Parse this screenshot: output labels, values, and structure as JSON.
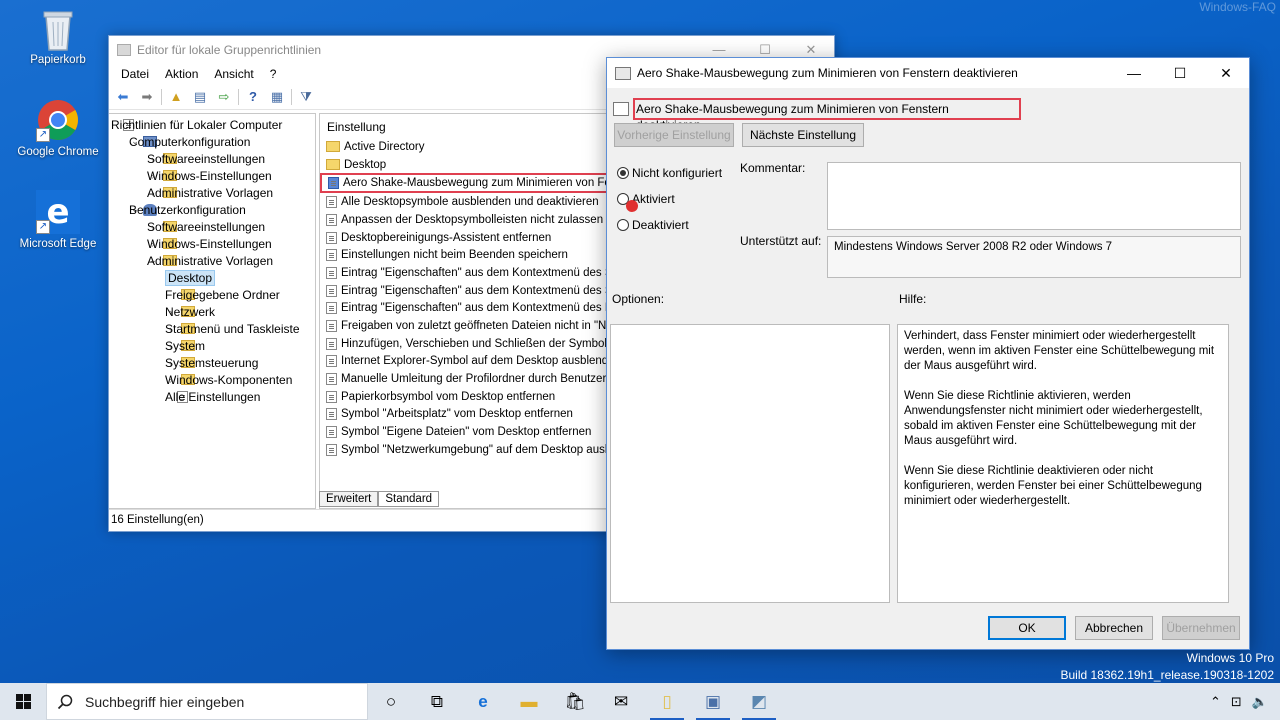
{
  "watermark": "Windows-FAQ",
  "desktop": {
    "icons": [
      {
        "label": "Papierkorb"
      },
      {
        "label": "Google Chrome"
      },
      {
        "label": "Microsoft Edge"
      }
    ],
    "winver_line1": "Windows 10 Pro",
    "winver_line2": "Build 18362.19h1_release.190318-1202"
  },
  "gpe": {
    "title": "Editor für lokale Gruppenrichtlinien",
    "menu": [
      "Datei",
      "Aktion",
      "Ansicht",
      "?"
    ],
    "tree": [
      {
        "label": "Richtlinien für Lokaler Computer",
        "level": 0,
        "icon": "policy-icon"
      },
      {
        "label": "Computerkonfiguration",
        "level": 1,
        "icon": "computer-icon",
        "twisty": "⌄"
      },
      {
        "label": "Softwareeinstellungen",
        "level": 2,
        "twisty": "›"
      },
      {
        "label": "Windows-Einstellungen",
        "level": 2,
        "twisty": "›"
      },
      {
        "label": "Administrative Vorlagen",
        "level": 2,
        "twisty": "›"
      },
      {
        "label": "Benutzerkonfiguration",
        "level": 1,
        "icon": "user-icon",
        "twisty": "⌄"
      },
      {
        "label": "Softwareeinstellungen",
        "level": 2,
        "twisty": "›"
      },
      {
        "label": "Windows-Einstellungen",
        "level": 2,
        "twisty": "›"
      },
      {
        "label": "Administrative Vorlagen",
        "level": 2,
        "twisty": "⌄"
      },
      {
        "label": "Desktop",
        "level": 3,
        "twisty": "›",
        "selected": true
      },
      {
        "label": "Freigegebene Ordner",
        "level": 3,
        "twisty": ""
      },
      {
        "label": "Netzwerk",
        "level": 3,
        "twisty": "›"
      },
      {
        "label": "Startmenü und Taskleiste",
        "level": 3,
        "twisty": "›"
      },
      {
        "label": "System",
        "level": 3,
        "twisty": "›"
      },
      {
        "label": "Systemsteuerung",
        "level": 3,
        "twisty": "›"
      },
      {
        "label": "Windows-Komponenten",
        "level": 3,
        "twisty": "›"
      },
      {
        "label": "Alle Einstellungen",
        "level": 3,
        "twisty": "",
        "icon": "settings-icon"
      }
    ],
    "list_header": "Einstellung",
    "list": [
      {
        "label": "Active Directory",
        "type": "folder"
      },
      {
        "label": "Desktop",
        "type": "folder"
      },
      {
        "label": "Aero Shake-Mausbewegung zum Minimieren von Fenstern deaktivieren",
        "type": "policy",
        "highlight": true
      },
      {
        "label": "Alle Desktopsymbole ausblenden und deaktivieren",
        "type": "policy"
      },
      {
        "label": "Anpassen der Desktopsymbolleisten nicht zulassen",
        "type": "policy"
      },
      {
        "label": "Desktopbereinigungs-Assistent entfernen",
        "type": "policy"
      },
      {
        "label": "Einstellungen nicht beim Beenden speichern",
        "type": "policy"
      },
      {
        "label": "Eintrag \"Eigenschaften\" aus dem Kontextmenü des Symbols",
        "type": "policy"
      },
      {
        "label": "Eintrag \"Eigenschaften\" aus dem Kontextmenü des Symbols",
        "type": "policy"
      },
      {
        "label": "Eintrag \"Eigenschaften\" aus dem Kontextmenü des Papierkorbs",
        "type": "policy"
      },
      {
        "label": "Freigaben von zuletzt geöffneten Dateien nicht in \"Netzwerk\"",
        "type": "policy"
      },
      {
        "label": "Hinzufügen, Verschieben und Schließen der Symbolleisten",
        "type": "policy"
      },
      {
        "label": "Internet Explorer-Symbol auf dem Desktop ausblenden",
        "type": "policy"
      },
      {
        "label": "Manuelle Umleitung der Profilordner durch Benutzer verhindern",
        "type": "policy"
      },
      {
        "label": "Papierkorbsymbol vom Desktop entfernen",
        "type": "policy"
      },
      {
        "label": "Symbol \"Arbeitsplatz\" vom Desktop entfernen",
        "type": "policy"
      },
      {
        "label": "Symbol \"Eigene Dateien\" vom Desktop entfernen",
        "type": "policy"
      },
      {
        "label": "Symbol \"Netzwerkumgebung\" auf dem Desktop ausblenden",
        "type": "policy"
      }
    ],
    "tabs": [
      "Erweitert",
      "Standard"
    ],
    "status": "16 Einstellung(en)"
  },
  "dialog": {
    "title": "Aero Shake-Mausbewegung zum Minimieren von Fenstern deaktivieren",
    "policy_name": "Aero Shake-Mausbewegung zum Minimieren von Fenstern deaktivieren",
    "prev_button": "Vorherige Einstellung",
    "next_button": "Nächste Einstellung",
    "radio_not_configured": "Nicht konfiguriert",
    "radio_enabled": "Aktiviert",
    "radio_disabled": "Deaktiviert",
    "selected": "Nicht konfiguriert",
    "comment_label": "Kommentar:",
    "supported_label": "Unterstützt auf:",
    "supported_value": "Mindestens Windows Server 2008 R2 oder Windows 7",
    "options_label": "Optionen:",
    "help_label": "Hilfe:",
    "help_paragraphs": [
      "Verhindert, dass Fenster minimiert oder wiederhergestellt werden, wenn im aktiven Fenster eine Schüttelbewegung mit der Maus ausgeführt wird.",
      "Wenn Sie diese Richtlinie aktivieren, werden Anwendungsfenster nicht minimiert oder wiederhergestellt, sobald im aktiven Fenster eine Schüttelbewegung mit der Maus ausgeführt wird.",
      "Wenn Sie diese Richtlinie deaktivieren oder nicht konfigurieren, werden Fenster bei einer Schüttelbewegung minimiert oder wiederhergestellt."
    ],
    "ok_button": "OK",
    "cancel_button": "Abbrechen",
    "apply_button": "Übernehmen"
  },
  "taskbar": {
    "search_placeholder": "Suchbegriff hier eingeben",
    "icons": [
      "cortana-icon",
      "task-view-icon",
      "edge-icon",
      "explorer-icon",
      "store-icon",
      "mail-icon",
      "notepad-icon",
      "gpedit-icon",
      "policy-window-icon"
    ]
  }
}
